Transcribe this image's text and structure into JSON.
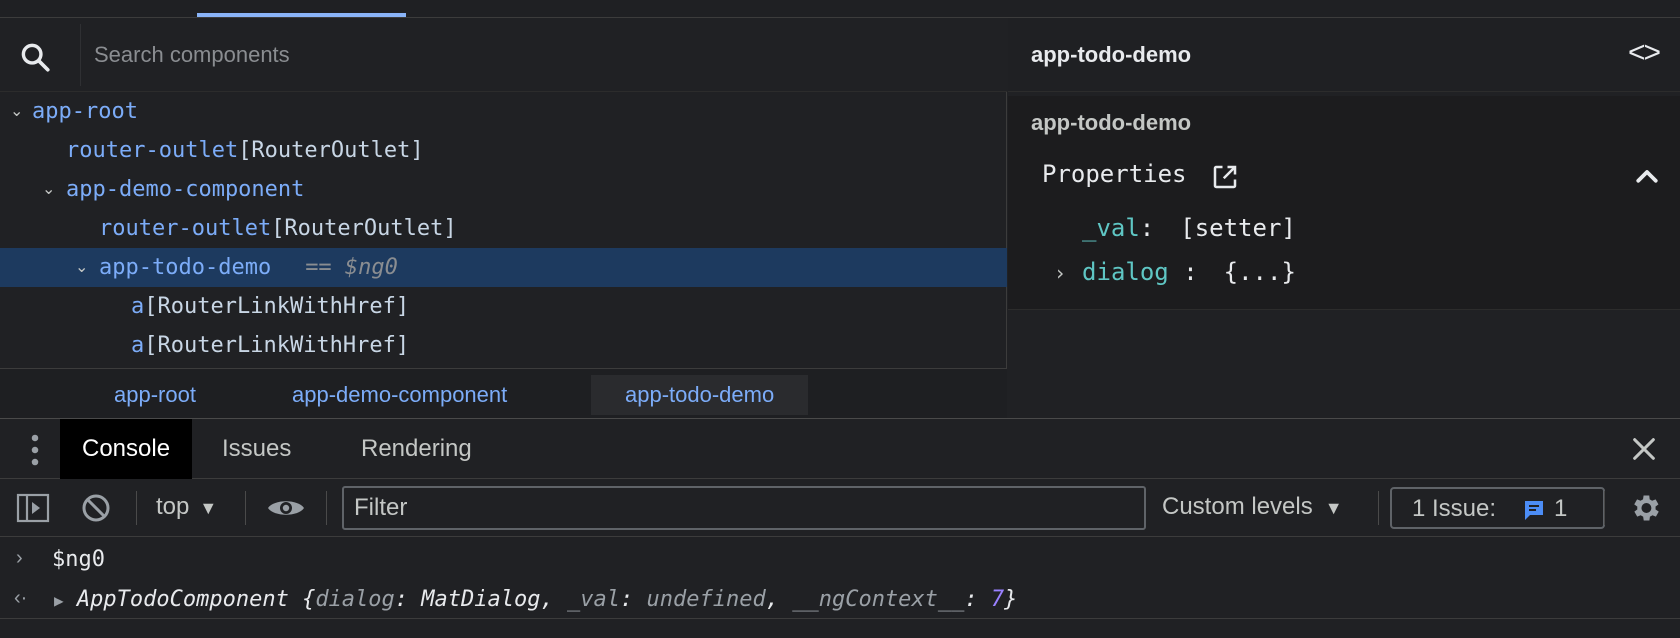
{
  "colors": {
    "tag": "#7cacf8",
    "selected_row": "#1d3a5f",
    "prop_key": "#5fc6c4",
    "number": "#9980ff",
    "issue_icon": "#4c8df6"
  },
  "component_tree": {
    "search": {
      "placeholder": "Search components",
      "icon": "search-icon"
    },
    "nodes": [
      {
        "expanded": true,
        "tag": "app-root",
        "directive": ""
      },
      {
        "expanded": null,
        "tag": "router-outlet",
        "directive": "[RouterOutlet]"
      },
      {
        "expanded": true,
        "tag": "app-demo-component",
        "directive": ""
      },
      {
        "expanded": null,
        "tag": "router-outlet",
        "directive": "[RouterOutlet]"
      },
      {
        "expanded": true,
        "tag": "app-todo-demo",
        "directive": "",
        "selected": true,
        "ref": "== $ng0"
      },
      {
        "expanded": null,
        "tag": "a",
        "directive": "[RouterLinkWithHref]"
      },
      {
        "expanded": null,
        "tag": "a",
        "directive": "[RouterLinkWithHref]"
      }
    ],
    "breadcrumb": [
      "app-root",
      "app-demo-component",
      "app-todo-demo"
    ]
  },
  "details": {
    "header_title": "app-todo-demo",
    "component_name": "app-todo-demo",
    "properties_label": "Properties",
    "properties": [
      {
        "key": "_val",
        "sep": ":",
        "value": "[setter]",
        "expandable": false
      },
      {
        "key": "dialog",
        "sep": " :",
        "value": "{...}",
        "expandable": true
      }
    ]
  },
  "drawer": {
    "tabs": [
      "Console",
      "Issues",
      "Rendering"
    ],
    "active_tab": "Console",
    "toolbar": {
      "context": "top",
      "filter_placeholder": "Filter",
      "levels": "Custom levels",
      "issues_label": "1 Issue:",
      "issues_count": "1"
    },
    "console": {
      "input": "$ng0",
      "result": {
        "class_name": "AppTodoComponent",
        "open": "{",
        "k1": "dialog",
        "v1": "MatDialog",
        "k2": "_val",
        "v2": "undefined",
        "k3": "__ngContext__",
        "v3": "7",
        "close": "}"
      }
    }
  }
}
